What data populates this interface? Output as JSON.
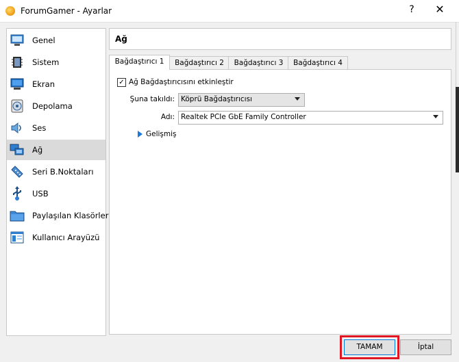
{
  "window": {
    "title": "ForumGamer - Ayarlar",
    "help": "?",
    "close": "✕"
  },
  "sidebar": {
    "items": [
      {
        "label": "Genel",
        "icon": "monitor-general-icon"
      },
      {
        "label": "Sistem",
        "icon": "chip-icon"
      },
      {
        "label": "Ekran",
        "icon": "display-icon"
      },
      {
        "label": "Depolama",
        "icon": "disk-icon"
      },
      {
        "label": "Ses",
        "icon": "speaker-icon"
      },
      {
        "label": "Ağ",
        "icon": "network-icon",
        "selected": true
      },
      {
        "label": "Seri B.Noktaları",
        "icon": "serial-port-icon"
      },
      {
        "label": "USB",
        "icon": "usb-icon"
      },
      {
        "label": "Paylaşılan Klasörler",
        "icon": "folder-icon"
      },
      {
        "label": "Kullanıcı Arayüzü",
        "icon": "ui-icon"
      }
    ]
  },
  "panel": {
    "title": "Ağ",
    "tabs": [
      {
        "label": "Bağdaştırıcı 1",
        "active": true
      },
      {
        "label": "Bağdaştırıcı 2"
      },
      {
        "label": "Bağdaştırıcı 3"
      },
      {
        "label": "Bağdaştırıcı 4"
      }
    ],
    "enable_label": "Ağ Bağdaştırıcısını etkinleştir",
    "enable_checked": true,
    "attached_label": "Şuna takıldı:",
    "attached_value": "Köprü Bağdaştırıcısı",
    "name_label": "Adı:",
    "name_value": "Realtek PCIe GbE Family Controller",
    "advanced_label": "Gelişmiş"
  },
  "buttons": {
    "ok": "TAMAM",
    "cancel": "İptal"
  },
  "colors": {
    "highlight_box": "#e01722",
    "accent": "#0078d7",
    "selected_item": "#dadada"
  }
}
